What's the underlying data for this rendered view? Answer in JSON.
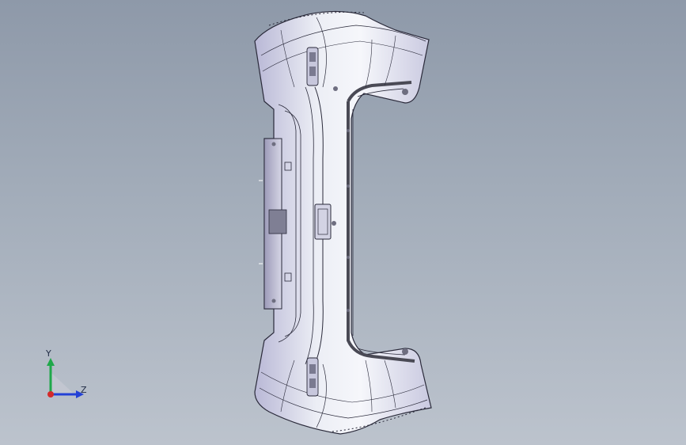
{
  "viewport": {
    "background_top": "#8e99a9",
    "background_bottom": "#bcc3cd"
  },
  "model": {
    "name": "bumper-part",
    "surface_color": "#e9eaf2",
    "shade_color": "#b8b8d4",
    "edge_color": "#2a2a3a"
  },
  "triad": {
    "y_label": "Y",
    "z_label": "Z",
    "y_color": "#1fa84a",
    "z_color": "#2341d6",
    "x_color": "#d42a2a"
  }
}
